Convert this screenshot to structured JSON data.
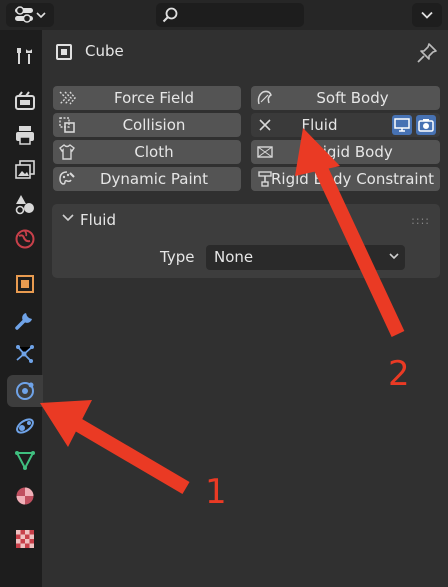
{
  "toolbar": {
    "editor_type_icon": "properties-editor-icon",
    "search_icon": "search-icon",
    "options_icon": "chevron-down-icon"
  },
  "sidebar": {
    "tabs": [
      {
        "id": "tool",
        "icon": "tool-icon"
      },
      {
        "id": "render",
        "icon": "render-icon"
      },
      {
        "id": "output",
        "icon": "output-icon"
      },
      {
        "id": "view-layer",
        "icon": "view-layer-icon"
      },
      {
        "id": "scene",
        "icon": "scene-icon"
      },
      {
        "id": "world",
        "icon": "world-icon"
      },
      {
        "id": "object",
        "icon": "object-icon"
      },
      {
        "id": "modifiers",
        "icon": "wrench-icon"
      },
      {
        "id": "particles",
        "icon": "particles-icon"
      },
      {
        "id": "physics",
        "icon": "physics-icon",
        "active": true
      },
      {
        "id": "constraints",
        "icon": "constraints-icon"
      },
      {
        "id": "data",
        "icon": "mesh-data-icon"
      },
      {
        "id": "material",
        "icon": "material-icon"
      },
      {
        "id": "texture",
        "icon": "texture-icon"
      }
    ]
  },
  "header": {
    "object_name": "Cube"
  },
  "physics": {
    "buttons": {
      "force_field": "Force Field",
      "soft_body": "Soft Body",
      "collision": "Collision",
      "fluid": "Fluid",
      "cloth": "Cloth",
      "rigid_body": "Rigid Body",
      "dynamic_paint": "Dynamic Paint",
      "rigid_body_constraint": "Rigid Body Constraint"
    },
    "active": "fluid"
  },
  "fluid_panel": {
    "title": "Fluid",
    "type_label": "Type",
    "type_value": "None"
  },
  "annotations": {
    "first": "1",
    "second": "2",
    "color": "#ea3a24"
  }
}
